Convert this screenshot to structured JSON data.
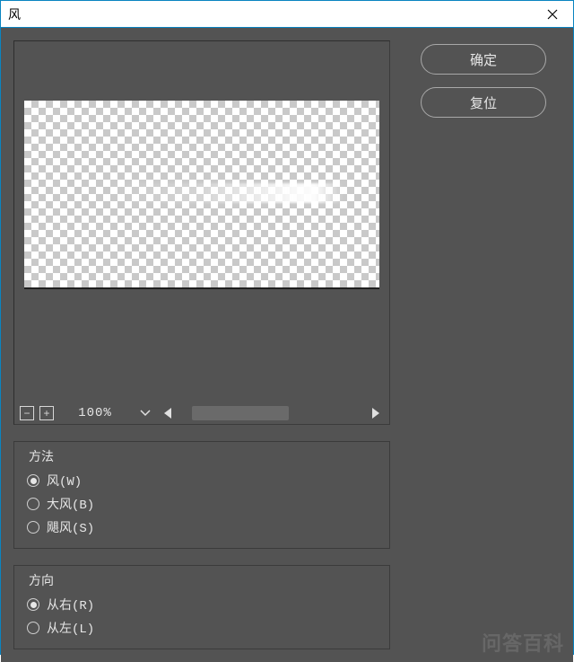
{
  "window": {
    "title": "风"
  },
  "buttons": {
    "ok": "确定",
    "reset": "复位"
  },
  "preview": {
    "zoom": "100%"
  },
  "method": {
    "legend": "方法",
    "options": [
      {
        "label": "风(W)",
        "checked": true
      },
      {
        "label": "大风(B)",
        "checked": false
      },
      {
        "label": "飓风(S)",
        "checked": false
      }
    ]
  },
  "direction": {
    "legend": "方向",
    "options": [
      {
        "label": "从右(R)",
        "checked": true
      },
      {
        "label": "从左(L)",
        "checked": false
      }
    ]
  },
  "watermark": "问答百科"
}
